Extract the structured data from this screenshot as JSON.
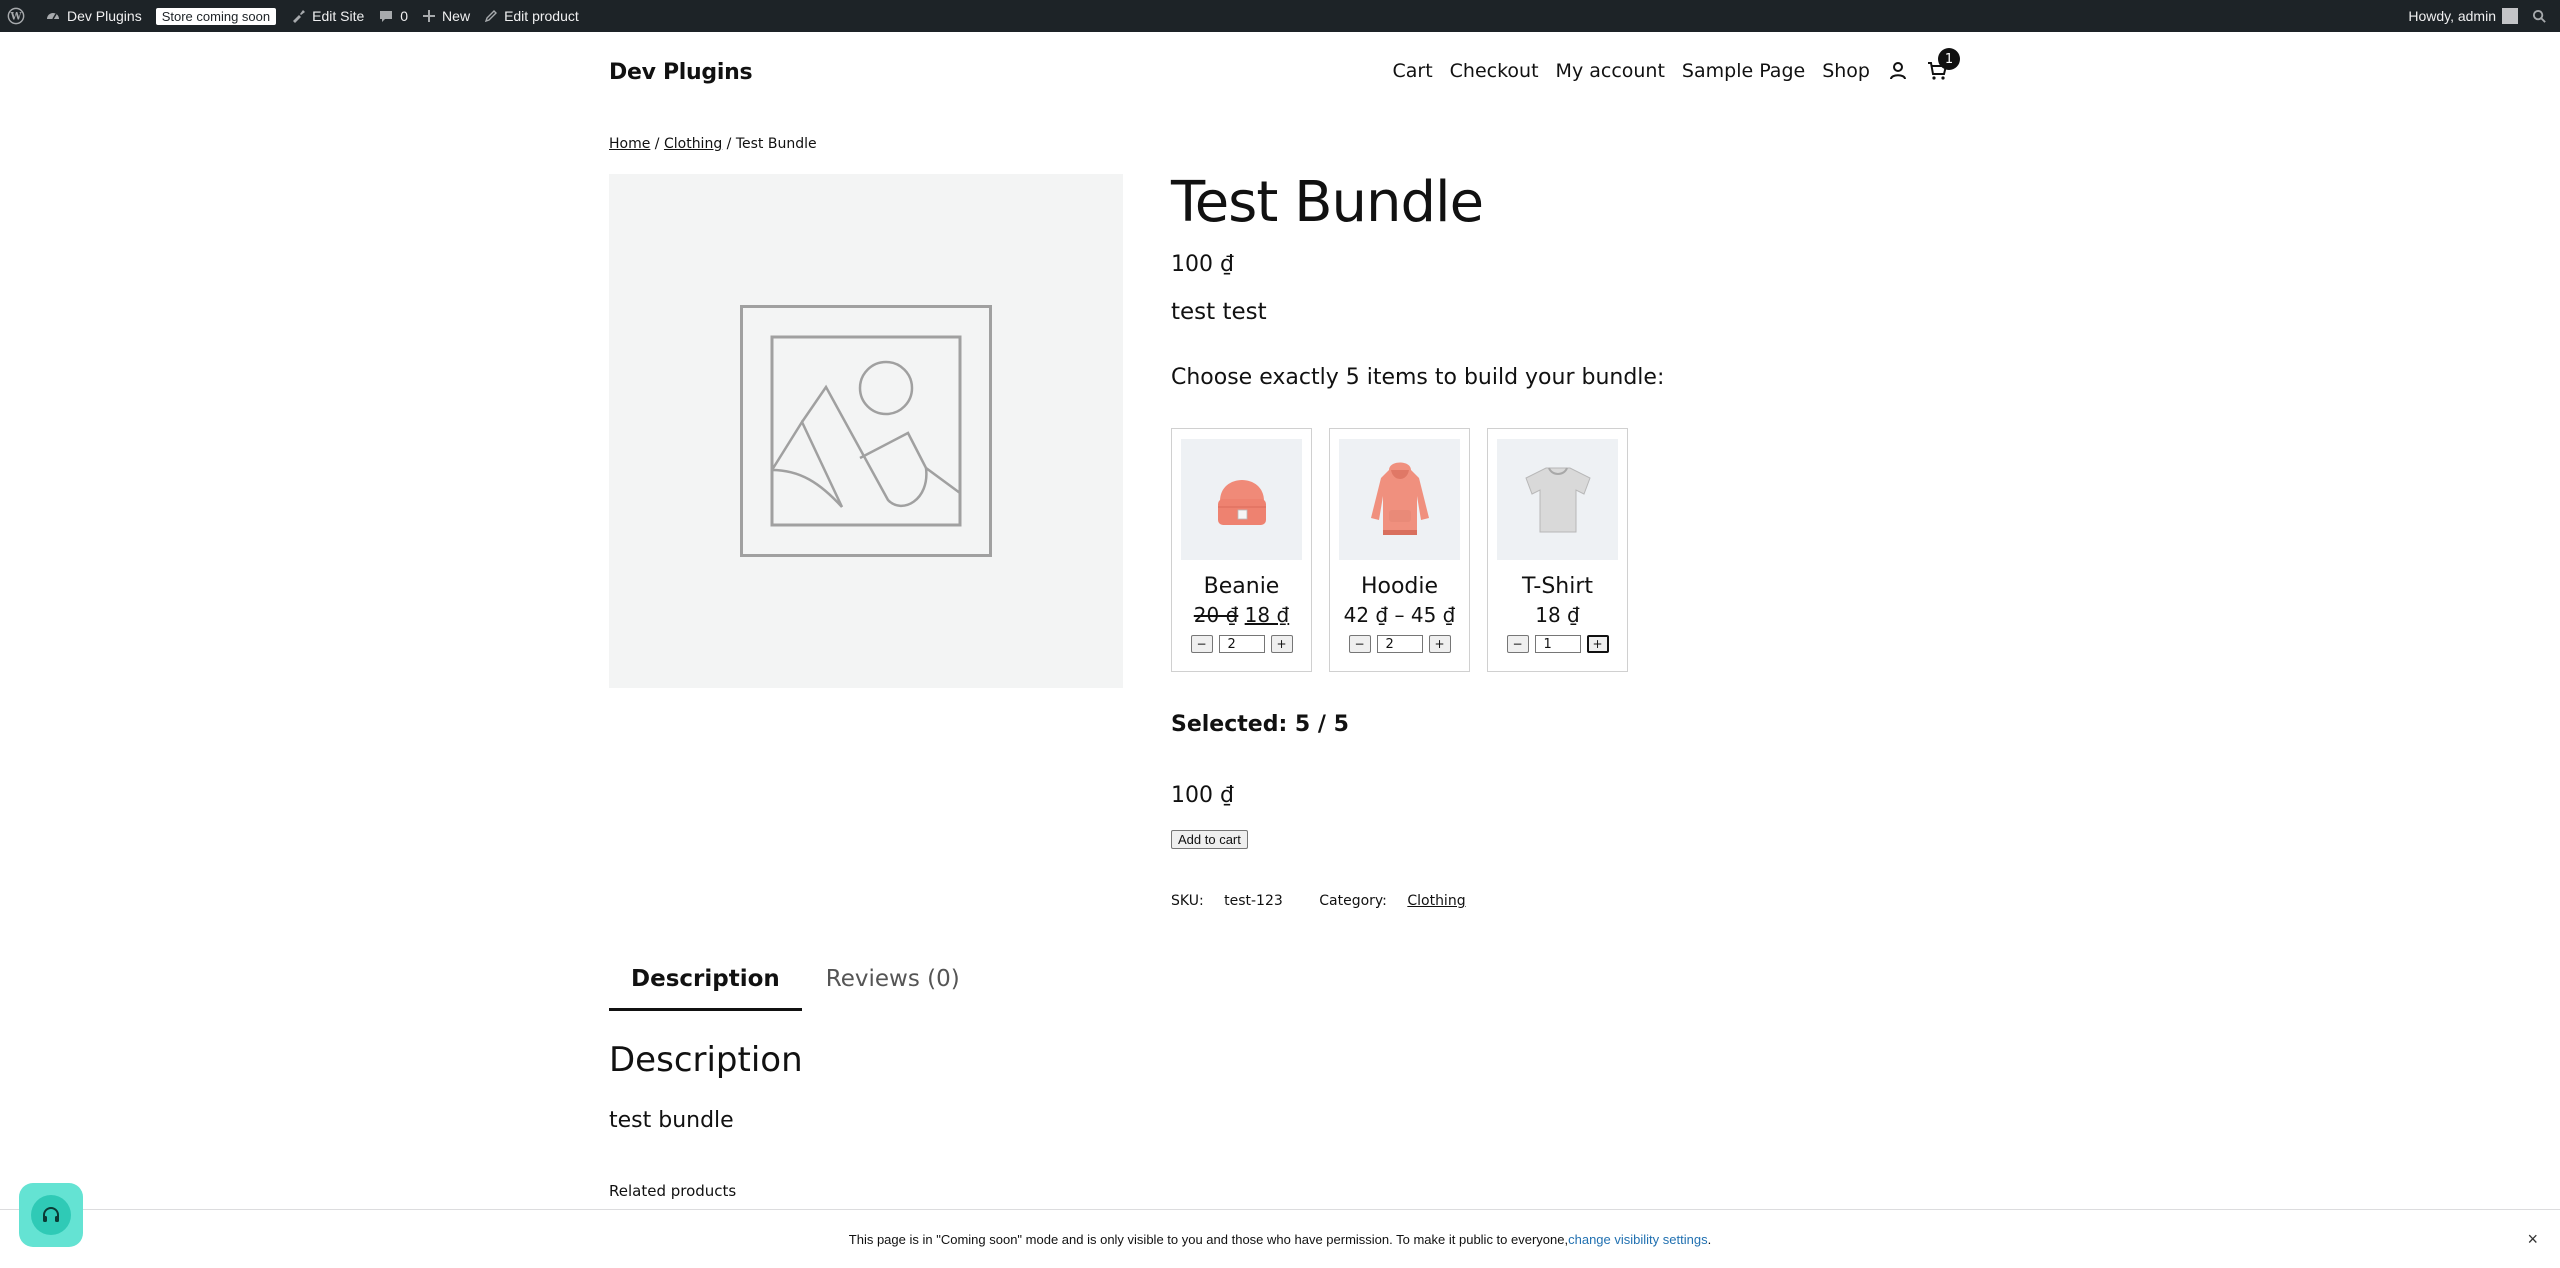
{
  "adminbar": {
    "site_name": "Dev Plugins",
    "status_badge": "Store coming soon",
    "edit_site": "Edit Site",
    "comments_count": "0",
    "new_label": "New",
    "edit_product": "Edit product",
    "greeting": "Howdy, admin"
  },
  "header": {
    "site_title": "Dev Plugins",
    "nav": [
      "Cart",
      "Checkout",
      "My account",
      "Sample Page",
      "Shop"
    ],
    "cart_count": "1"
  },
  "breadcrumb": {
    "home": "Home",
    "separator": "/",
    "category": "Clothing",
    "current": "Test Bundle"
  },
  "product": {
    "title": "Test Bundle",
    "price": "100 ₫",
    "short_description": "test test",
    "bundle_heading": "Choose exactly 5 items to build your bundle:",
    "items": [
      {
        "name": "Beanie",
        "old_price": "20 ₫",
        "price": "18 ₫",
        "qty": "2"
      },
      {
        "name": "Hoodie",
        "price": "42 ₫ – 45 ₫",
        "qty": "2"
      },
      {
        "name": "T-Shirt",
        "price": "18 ₫",
        "qty": "1"
      }
    ],
    "minus": "−",
    "plus": "+",
    "selected": "Selected: 5 / 5",
    "total": "100 ₫",
    "add_to_cart": "Add to cart",
    "sku_label": "SKU:",
    "sku": "test-123",
    "category_label": "Category:",
    "category": "Clothing"
  },
  "tabs": [
    "Description",
    "Reviews (0)"
  ],
  "description": {
    "heading": "Description",
    "text": "test bundle"
  },
  "related": "Related products",
  "notice": {
    "text": "This page is in \"Coming soon\" mode and is only visible to you and those who have permission. To make it public to everyone, ",
    "link": "change visibility settings",
    "end": ".",
    "close": "×"
  },
  "colors": {
    "adminbar": "#1d2327",
    "image_bg": "#f3f4f4",
    "help_button": "#64e3d3",
    "link_blue": "#2271b1"
  }
}
